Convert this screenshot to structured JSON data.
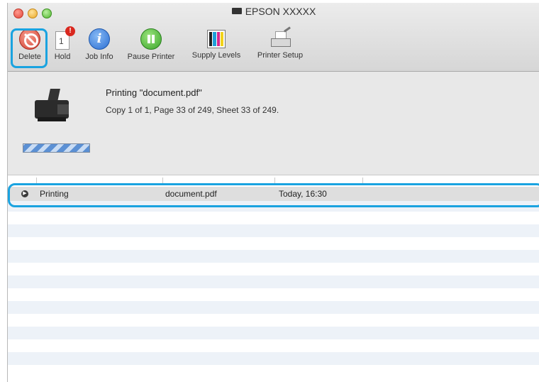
{
  "window": {
    "title": "EPSON XXXXX"
  },
  "toolbar": {
    "delete_label": "Delete",
    "hold_label": "Hold",
    "hold_doc_number": "1",
    "hold_alert": "!",
    "job_info_label": "Job Info",
    "job_info_glyph": "i",
    "pause_label": "Pause Printer",
    "supply_label": "Supply Levels",
    "setup_label": "Printer Setup",
    "highlight_color": "#1aa3e0"
  },
  "status": {
    "title": "Printing \"document.pdf\"",
    "detail": "Copy 1 of 1, Page 33 of 249, Sheet 33 of 249."
  },
  "jobs": [
    {
      "icon": "arrow-right-icon",
      "status": "Printing",
      "name": "document.pdf",
      "date": "Today, 16:30"
    }
  ],
  "ink_colors": [
    "#222222",
    "#1e9fd8",
    "#d6288f",
    "#f2d21b"
  ]
}
